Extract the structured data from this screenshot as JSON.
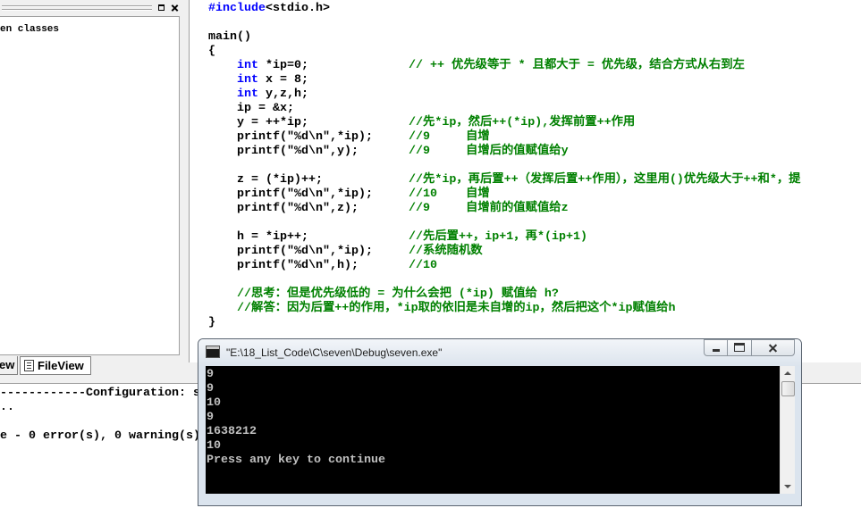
{
  "workspace": {
    "tree_item": "en classes",
    "tabs": {
      "class_view": "ew",
      "file_view": "FileView"
    }
  },
  "editor": {
    "colors": {
      "keyword": "#0000ff",
      "comment": "#008000",
      "text": "#000000"
    },
    "lines": [
      {
        "kw": "#include",
        "code": "<stdio.h>"
      },
      {
        "code": "main()"
      },
      {
        "code": "{"
      },
      {
        "kw": "int",
        "code": " *ip=0;",
        "comment": "// ++ 优先级等于 * 且都大于 = 优先级，结合方式从右到左"
      },
      {
        "kw": "int",
        "code": " x = 8;"
      },
      {
        "kw": "int",
        "code": " y,z,h;"
      },
      {
        "code": "ip = &x;"
      },
      {
        "code": "y = ++*ip;",
        "comment": "//先*ip，然后++(*ip),发挥前置++作用"
      },
      {
        "code": "printf(\"%d\\n\",*ip);",
        "comment": "//9     自增"
      },
      {
        "code": "printf(\"%d\\n\",y);",
        "comment": "//9     自增后的值赋值给y"
      },
      {
        "code": "z = (*ip)++;",
        "comment": "//先*ip，再后置++（发挥后置++作用），这里用()优先级大于++和*，提"
      },
      {
        "code": "printf(\"%d\\n\",*ip);",
        "comment": "//10    自增"
      },
      {
        "code": "printf(\"%d\\n\",z);",
        "comment": "//9     自增前的值赋值给z"
      },
      {
        "code": "h = *ip++;",
        "comment": "//先后置++，ip+1，再*(ip+1)"
      },
      {
        "code": "printf(\"%d\\n\",*ip);",
        "comment": "//系统随机数"
      },
      {
        "code": "printf(\"%d\\n\",h);",
        "comment": "//10"
      },
      {
        "comment": "//思考：但是优先级低的 = 为什么会把 (*ip) 赋值给 h?"
      },
      {
        "comment": "//解答：因为后置++的作用，*ip取的依旧是未自增的ip，然后把这个*ip赋值给h"
      },
      {
        "code": "}"
      }
    ]
  },
  "output": {
    "lines": [
      "------------Configuration: s",
      "..",
      "e - 0 error(s), 0 warning(s)"
    ]
  },
  "console": {
    "title": "\"E:\\18_List_Code\\C\\seven\\Debug\\seven.exe\"",
    "colors": {
      "background": "#000000",
      "text": "#c0c0c0"
    },
    "lines": [
      "9",
      "9",
      "10",
      "9",
      "1638212",
      "10",
      "Press any key to continue"
    ]
  }
}
